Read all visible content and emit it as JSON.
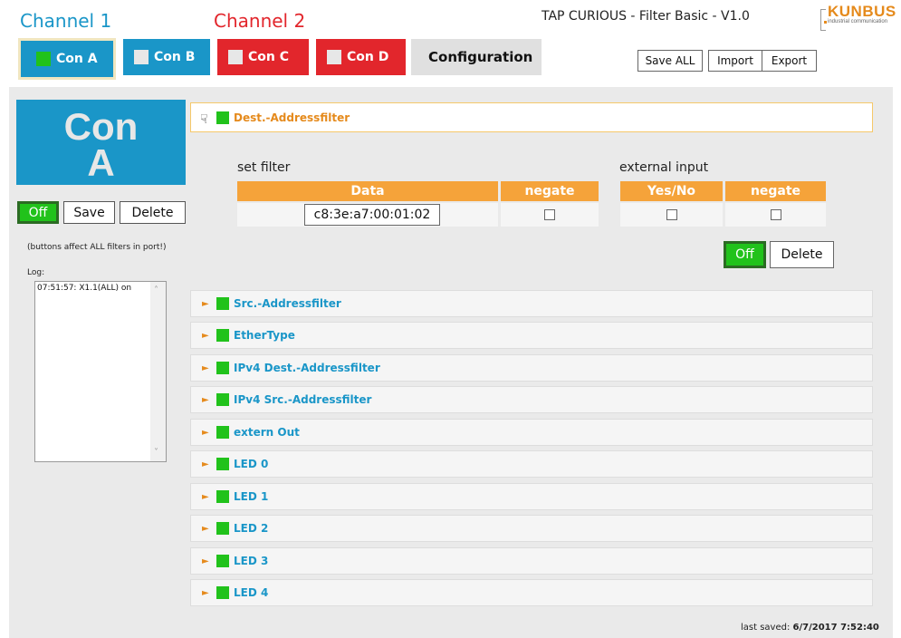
{
  "header": {
    "channel1": "Channel 1",
    "channel2": "Channel 2",
    "app_title": "TAP CURIOUS - Filter Basic - V1.0",
    "logo": "KUNBUS",
    "logo_sub": "industrial communication"
  },
  "tabs": [
    {
      "label": "Con A",
      "color": "#1a96c8",
      "indicator": "#21c21b",
      "active": true
    },
    {
      "label": "Con B",
      "color": "#1a96c8",
      "indicator": "#e7e7e7"
    },
    {
      "label": "Con C",
      "color": "#e2262c",
      "indicator": "#e7e7e7"
    },
    {
      "label": "Con D",
      "color": "#e2262c",
      "indicator": "#e7e7e7"
    },
    {
      "label": "Configuration",
      "color": "#e0e0e0"
    }
  ],
  "toolbar": {
    "save_all": "Save ALL",
    "import": "Import",
    "export": "Export"
  },
  "left": {
    "con_line1": "Con",
    "con_line2": "A",
    "off": "Off",
    "save": "Save",
    "delete": "Delete",
    "hint": "(buttons affect ALL filters in port!)",
    "log_label": "Log:",
    "log_entries": "07:51:57: X1.1(ALL) on"
  },
  "filter": {
    "title": "Dest.-Addressfilter",
    "set_filter": "set filter",
    "external_input": "external input",
    "col_data": "Data",
    "col_negate": "negate",
    "col_yesno": "Yes/No",
    "col_negate2": "negate",
    "data_value": "c8:3e:a7:00:01:02",
    "off": "Off",
    "delete": "Delete"
  },
  "filters": [
    "Src.-Addressfilter",
    "EtherType",
    "IPv4 Dest.-Addressfilter",
    "IPv4 Src.-Addressfilter",
    "extern Out",
    "LED 0",
    "LED 1",
    "LED 2",
    "LED 3",
    "LED 4"
  ],
  "footer": {
    "last_saved_label": "last saved:",
    "last_saved_value": "6/7/2017 7:52:40"
  }
}
